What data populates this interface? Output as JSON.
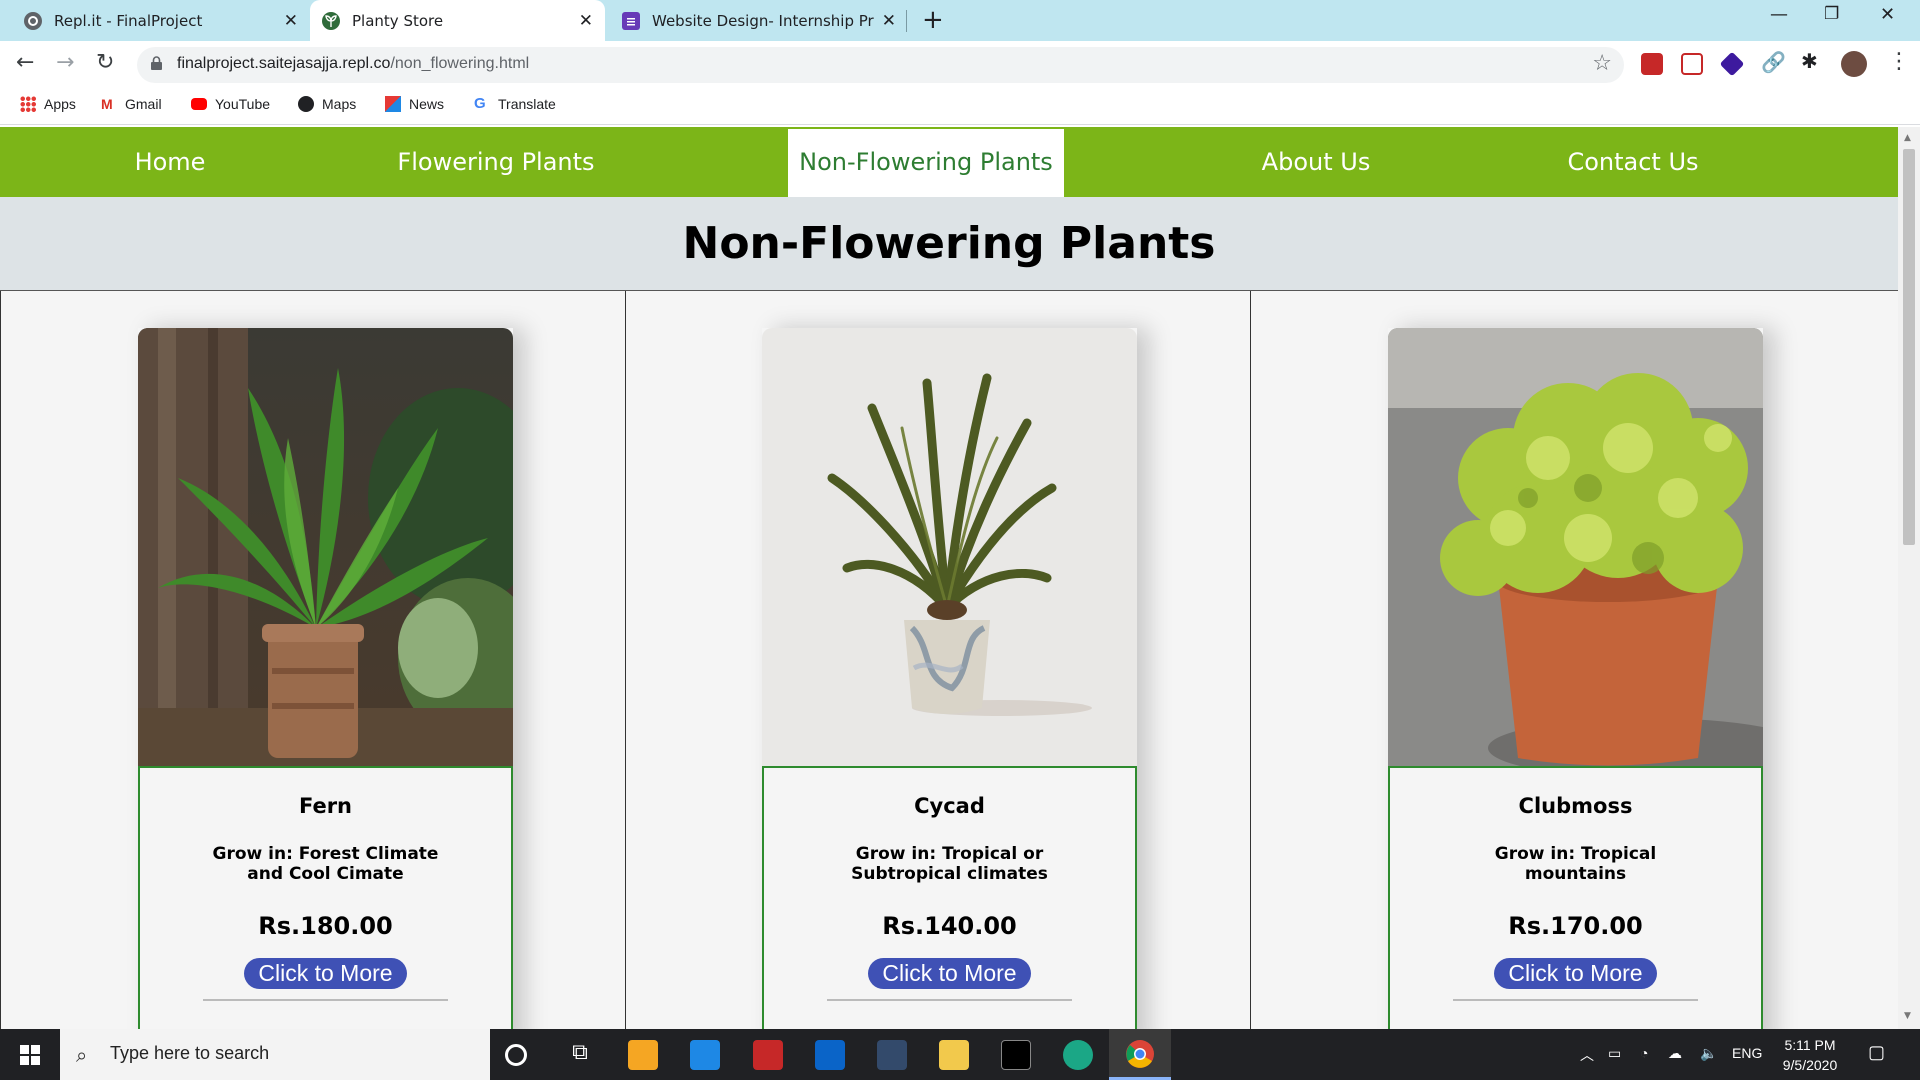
{
  "browser": {
    "tabs": [
      {
        "title": "Repl.it - FinalProject",
        "icon": "replit-icon"
      },
      {
        "title": "Planty Store",
        "icon": "plant-icon"
      },
      {
        "title": "Website Design- Internship Proje",
        "icon": "forms-icon"
      }
    ],
    "url_host": "finalproject.saitejasajja.repl.co",
    "url_path": "/non_flowering.html",
    "bookmarks": [
      "Apps",
      "Gmail",
      "YouTube",
      "Maps",
      "News",
      "Translate"
    ]
  },
  "site": {
    "nav": [
      "Home",
      "Flowering Plants",
      "Non-Flowering Plants",
      "About Us",
      "Contact Us"
    ],
    "active_nav": "Non-Flowering Plants",
    "page_title": "Non-Flowering Plants",
    "accent_color": "#7cb518",
    "button_color": "#3f51b5",
    "products": [
      {
        "name": "Fern",
        "grow": "Grow in: Forest Climate and Cool Cimate",
        "price": "Rs.180.00",
        "button": "Click to More"
      },
      {
        "name": "Cycad",
        "grow": "Grow in: Tropical or Subtropical climates",
        "price": "Rs.140.00",
        "button": "Click to More"
      },
      {
        "name": "Clubmoss",
        "grow": "Grow in: Tropical mountains",
        "price": "Rs.170.00",
        "button": "Click to More"
      }
    ]
  },
  "taskbar": {
    "search_placeholder": "Type here to search",
    "language": "ENG",
    "time": "5:11 PM",
    "date": "9/5/2020"
  }
}
